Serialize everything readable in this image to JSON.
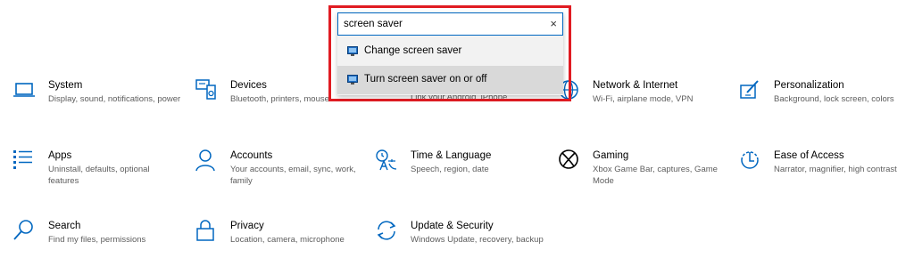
{
  "colors": {
    "icon_blue": "#0067c0",
    "highlight": "#e01b22"
  },
  "search": {
    "value": "screen saver",
    "clear_label": "×"
  },
  "suggestions": [
    {
      "label": "Change screen saver",
      "icon": "screen-saver-icon"
    },
    {
      "label": "Turn screen saver on or off",
      "icon": "screen-saver-icon"
    }
  ],
  "partial_text": "Link your Android, iPhone",
  "tiles": {
    "system": {
      "title": "System",
      "desc": "Display, sound, notifications, power",
      "icon": "laptop-icon"
    },
    "devices": {
      "title": "Devices",
      "desc": "Bluetooth, printers, mouse",
      "icon": "keyboard-speaker-icon"
    },
    "network": {
      "title": "Network & Internet",
      "desc": "Wi-Fi, airplane mode, VPN",
      "icon": "globe-icon"
    },
    "personalization": {
      "title": "Personalization",
      "desc": "Background, lock screen, colors",
      "icon": "pen-tablet-icon"
    },
    "apps": {
      "title": "Apps",
      "desc": "Uninstall, defaults, optional features",
      "icon": "apps-list-icon"
    },
    "accounts": {
      "title": "Accounts",
      "desc": "Your accounts, email, sync, work, family",
      "icon": "person-icon"
    },
    "time_language": {
      "title": "Time & Language",
      "desc": "Speech, region, date",
      "icon": "time-language-icon"
    },
    "gaming": {
      "title": "Gaming",
      "desc": "Xbox Game Bar, captures, Game Mode",
      "icon": "xbox-icon"
    },
    "ease": {
      "title": "Ease of Access",
      "desc": "Narrator, magnifier, high contrast",
      "icon": "ease-of-access-icon"
    },
    "search": {
      "title": "Search",
      "desc": "Find my files, permissions",
      "icon": "search-icon"
    },
    "privacy": {
      "title": "Privacy",
      "desc": "Location, camera, microphone",
      "icon": "lock-icon"
    },
    "update": {
      "title": "Update & Security",
      "desc": "Windows Update, recovery, backup",
      "icon": "sync-arrows-icon"
    }
  }
}
